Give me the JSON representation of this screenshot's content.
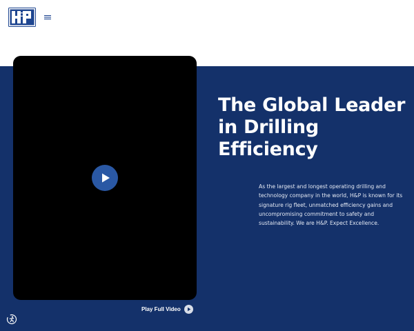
{
  "header": {
    "logo": {
      "text": "H&P",
      "icon": "company-logo"
    },
    "menu": {
      "icon": "hamburger-menu-icon"
    }
  },
  "hero": {
    "title_lines": [
      "The Global Leader",
      "in Drilling",
      "Efficiency"
    ],
    "description_lines": [
      "As the largest and longest operating drilling and",
      "technology company in the world, H&P is known for its",
      "signature rig fleet, unmatched efficiency gains and",
      "uncompromising commitment to safety and",
      "sustainability. We are H&P. Expect Excellence."
    ],
    "video": {
      "play_icon": "play-icon"
    },
    "full_video_link": {
      "label": "Play Full Video",
      "icon": "play-circle-icon"
    }
  },
  "accessibility": {
    "icon": "accessibility-icon"
  },
  "colors": {
    "hero_background": "#14316a",
    "brand_blue": "#1f4690",
    "play_button": "#2a58a4",
    "video_background": "#000000",
    "text_light": "#ffffff"
  }
}
